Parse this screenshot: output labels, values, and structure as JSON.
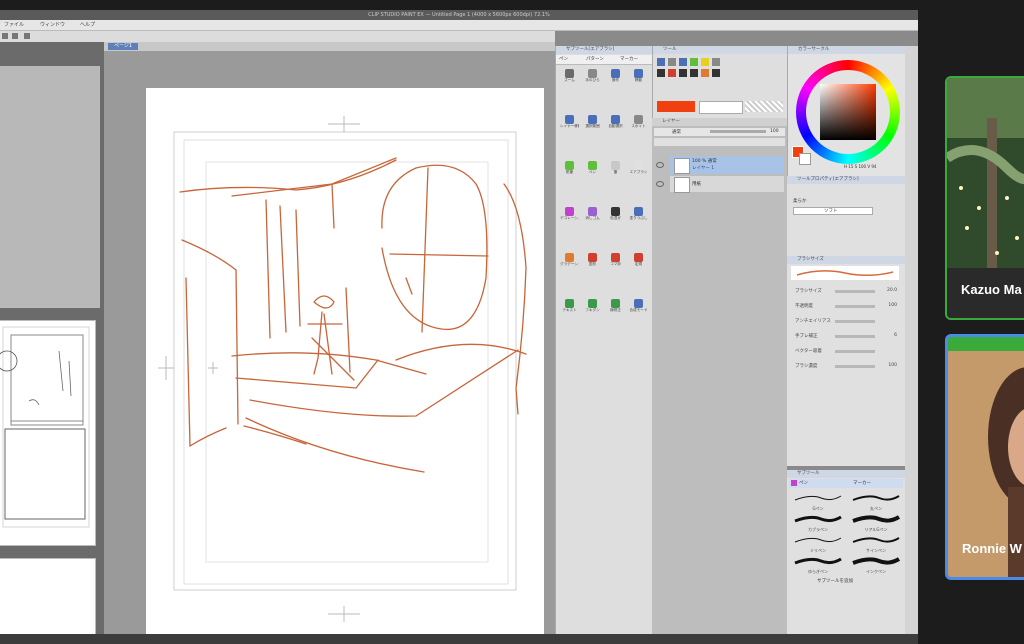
{
  "app": {
    "title": "CLIP STUDIO PAINT EX — Untitled Page 1 (4000 x 5600px 600dpi) 72.1%",
    "menu": [
      "ファイル",
      "ウィンドウ",
      "ヘルプ"
    ],
    "canvas_tab": "ページ1",
    "subtool_tabs": [
      "ペン",
      "パターン",
      "マーカー"
    ]
  },
  "subtools": {
    "title": "サブツール[エアブラシ]",
    "buttons": [
      {
        "label": "ズーム",
        "color": "#6b6b6b"
      },
      {
        "label": "手のひら",
        "color": "#888888"
      },
      {
        "label": "操作",
        "color": "#4a6fb8"
      },
      {
        "label": "移動",
        "color": "#4a6fb8"
      },
      {
        "label": "レイヤー移動",
        "color": "#4a6fb8"
      },
      {
        "label": "選択範囲",
        "color": "#4a6fb8"
      },
      {
        "label": "自動選択",
        "color": "#4a6fb8"
      },
      {
        "label": "スポイト",
        "color": "#888888"
      },
      {
        "label": "鉛筆",
        "color": "#5fbf3a"
      },
      {
        "label": "ペン",
        "color": "#5fbf3a"
      },
      {
        "label": "筆",
        "color": "#c8c8c8"
      },
      {
        "label": "エアブラシ",
        "color": "#e0e0e0"
      },
      {
        "label": "デコレーション",
        "color": "#c040d0"
      },
      {
        "label": "消しゴム",
        "color": "#9a5fd0"
      },
      {
        "label": "色混ぜ",
        "color": "#333333"
      },
      {
        "label": "塗りつぶし",
        "color": "#4a6fb8"
      },
      {
        "label": "グラデーション",
        "color": "#e07a30"
      },
      {
        "label": "図形",
        "color": "#d04030"
      },
      {
        "label": "コマ枠",
        "color": "#d04030"
      },
      {
        "label": "定規",
        "color": "#d04030"
      },
      {
        "label": "テキスト",
        "color": "#3a9a4a"
      },
      {
        "label": "フキダシ",
        "color": "#3a9a4a"
      },
      {
        "label": "線修正",
        "color": "#3a9a4a"
      },
      {
        "label": "合成モード",
        "color": "#4a6fb8"
      }
    ]
  },
  "tool_panel": {
    "title": "ツール",
    "colors": [
      "#f04010",
      "#ffffff"
    ]
  },
  "layers": {
    "title": "レイヤー",
    "blend_mode": "通常",
    "opacity": "100",
    "items": [
      {
        "name": "レイヤー 1",
        "sub": "100 % 通常"
      },
      {
        "name": "用紙",
        "sub": ""
      }
    ]
  },
  "color_wheel": {
    "title": "カラーサークル",
    "main_color": "#f04010",
    "hsv": "H 15 S 100 V 94"
  },
  "tool_property": {
    "title": "ツールプロパティ[エアブラシ]",
    "label": "柔らか",
    "value": "ソフト"
  },
  "brush": {
    "title": "ブラシサイズ",
    "rows": [
      {
        "label": "ブラシサイズ",
        "value": "20.0"
      },
      {
        "label": "不透明度",
        "value": "100"
      },
      {
        "label": "アンチエイリアス",
        "value": ""
      },
      {
        "label": "手ブレ補正",
        "value": "6"
      },
      {
        "label": "ベクター吸着",
        "value": ""
      },
      {
        "label": "ブラシ濃度",
        "value": "100"
      }
    ]
  },
  "materials": {
    "title": "サブツール",
    "tabs": [
      "ペン",
      "マーカー"
    ],
    "items": [
      "Gペン",
      "丸ペン",
      "カブラペン",
      "リアルGペン",
      "ミリペン",
      "サインペン",
      "ゆらぎペン",
      "インクペン"
    ],
    "add_label": "サブツールを追加"
  },
  "participants": [
    {
      "name": "Kazuo Ma"
    },
    {
      "name": "Ronnie W"
    }
  ]
}
